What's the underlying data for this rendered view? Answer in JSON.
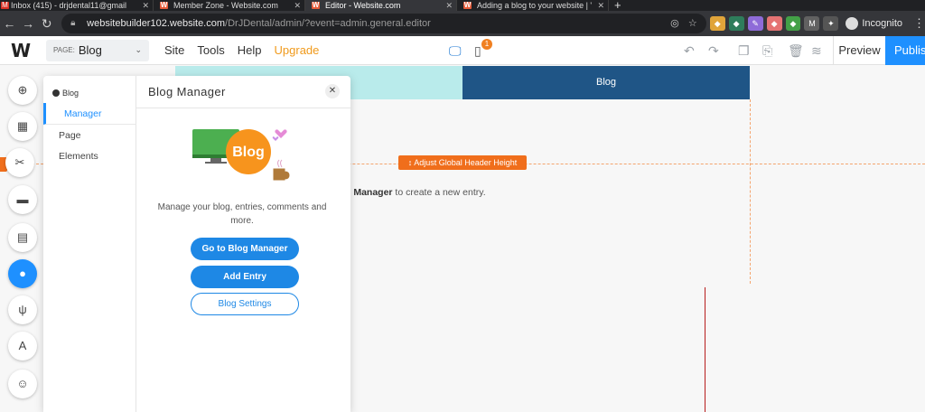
{
  "browser": {
    "tabs": [
      {
        "title": "Inbox (415) - drjdental11@gmail",
        "icon": "gmail-icon",
        "active": false
      },
      {
        "title": "Member Zone - Website.com",
        "icon": "website-icon",
        "active": false
      },
      {
        "title": "Editor - Website.com",
        "icon": "website-icon",
        "active": true
      },
      {
        "title": "Adding a blog to your website | '",
        "icon": "website-icon",
        "active": false
      }
    ],
    "new_tab": "+",
    "url_host": "websitebuilder102.website.com",
    "url_path": "/DrJDental/admin/?event=admin.general.editor",
    "profile_label": "Incognito"
  },
  "editor": {
    "logo": "W",
    "page_prefix": "PAGE:",
    "page_name": "Blog",
    "menu": {
      "site": "Site",
      "tools": "Tools",
      "help": "Help",
      "upgrade": "Upgrade"
    },
    "notification_count": "1",
    "preview_label": "Preview",
    "publish_label": "Publish"
  },
  "canvas": {
    "header_nav_label": "Blog",
    "adjust_header_label": "Adjust Global Header Height",
    "placeholder_bold": "g Manager",
    "placeholder_rest": " to create a new entry."
  },
  "panel": {
    "section_label": "Blog",
    "nav": [
      "Manager",
      "Page",
      "Elements"
    ],
    "title": "Blog Manager",
    "illustration_text": "Blog",
    "description": "Manage your blog, entries, comments and more.",
    "buttons": {
      "go_to_manager": "Go to Blog Manager",
      "add_entry": "Add Entry",
      "settings": "Blog Settings"
    }
  },
  "colors": {
    "accent": "#1e90ff",
    "orange": "#f06e1b",
    "header_dark": "#1f5586",
    "header_light": "#b9ebeb",
    "upgrade": "#f09a1b"
  }
}
